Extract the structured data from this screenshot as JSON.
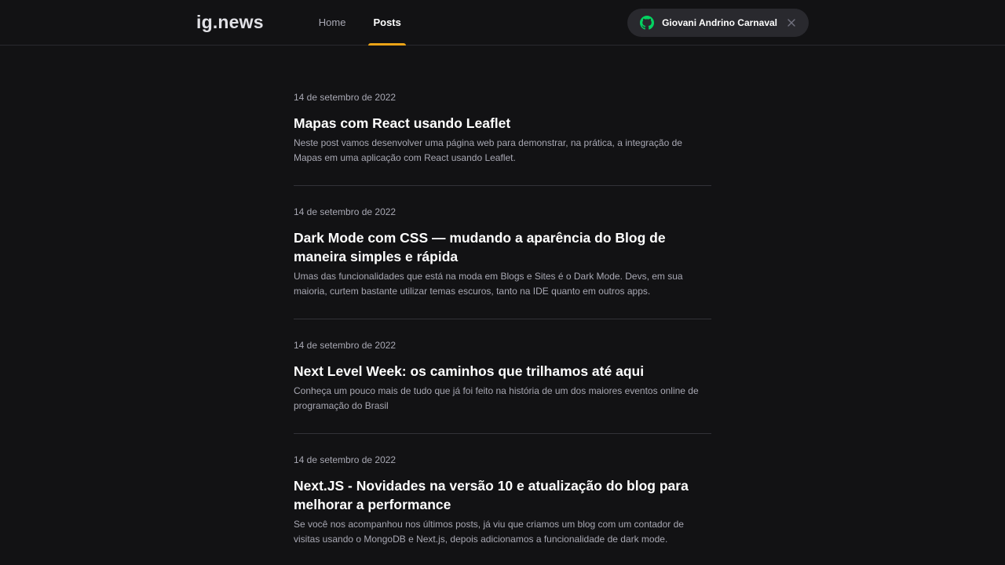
{
  "app": {
    "logo": "ig.news"
  },
  "nav": {
    "items": [
      {
        "label": "Home",
        "active": false
      },
      {
        "label": "Posts",
        "active": true
      }
    ]
  },
  "user": {
    "name": "Giovani Andrino Carnaval",
    "icon": "github-icon",
    "icon_color": "#04d361",
    "close_icon": "close-icon"
  },
  "colors": {
    "accent": "#eba417",
    "background": "#121214",
    "button_bg": "#29292e"
  },
  "posts": [
    {
      "date": "14 de setembro de 2022",
      "title": "Mapas com React usando Leaflet",
      "excerpt": "Neste post vamos desenvolver uma página web para demonstrar, na prática, a integração de Mapas em uma aplicação com React usando Leaflet."
    },
    {
      "date": "14 de setembro de 2022",
      "title": "Dark Mode com CSS — mudando a aparência do Blog de maneira simples e rápida",
      "excerpt": "Umas das funcionalidades que está na moda em Blogs e Sites é o Dark Mode. Devs, em sua maioria, curtem bastante utilizar temas escuros, tanto na IDE quanto em outros apps."
    },
    {
      "date": "14 de setembro de 2022",
      "title": "Next Level Week: os caminhos que trilhamos até aqui",
      "excerpt": "Conheça um pouco mais de tudo que já foi feito na história de um dos maiores eventos online de programação do Brasil"
    },
    {
      "date": "14 de setembro de 2022",
      "title": "Next.JS - Novidades na versão 10 e atualização do blog para melhorar a performance",
      "excerpt": "Se você nos acompanhou nos últimos posts, já viu que criamos um blog com um contador de visitas usando o MongoDB e Next.js, depois adicionamos a funcionalidade de dark mode."
    }
  ]
}
